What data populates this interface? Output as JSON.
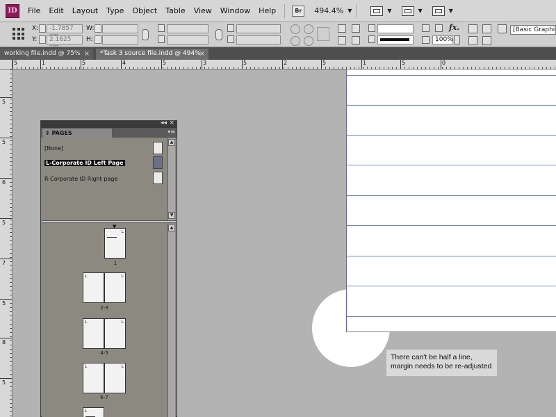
{
  "menubar": {
    "logo": "ID",
    "items": [
      "File",
      "Edit",
      "Layout",
      "Type",
      "Object",
      "Table",
      "View",
      "Window",
      "Help"
    ],
    "bridge_label": "Br",
    "zoom": "494.4%"
  },
  "control": {
    "x_label": "X:",
    "x_value": "-1.7857 cm",
    "y_label": "Y:",
    "y_value": "2.1625 cm",
    "w_label": "W:",
    "h_label": "H:",
    "opacity": "100%",
    "fx_label": "fx.",
    "paragraph_style": "[Basic Graphics Frame]"
  },
  "tabs": [
    {
      "label": "working file.indd @ 75%"
    },
    {
      "label": "*Task 3 source file.indd @ 494%"
    }
  ],
  "ruler_h": [
    "5",
    "1",
    "5",
    "4",
    "5",
    "3",
    "5",
    "2",
    "5",
    "1",
    "5",
    "0"
  ],
  "ruler_v": [
    "5",
    "5",
    "6",
    "5",
    "7",
    "5",
    "8",
    "5"
  ],
  "pages_panel": {
    "title": "PAGES",
    "masters": [
      {
        "label": "[None]"
      },
      {
        "label": "L-Corporate ID Left Page"
      },
      {
        "label": "R-Corporate ID Right page"
      }
    ],
    "page_labels": [
      "1",
      "2-3",
      "4-5",
      "6-7"
    ],
    "L": "L",
    "R": "R"
  },
  "callout": {
    "line1": "There can't be half a line,",
    "line2": "margin needs to be re-adjusted"
  }
}
